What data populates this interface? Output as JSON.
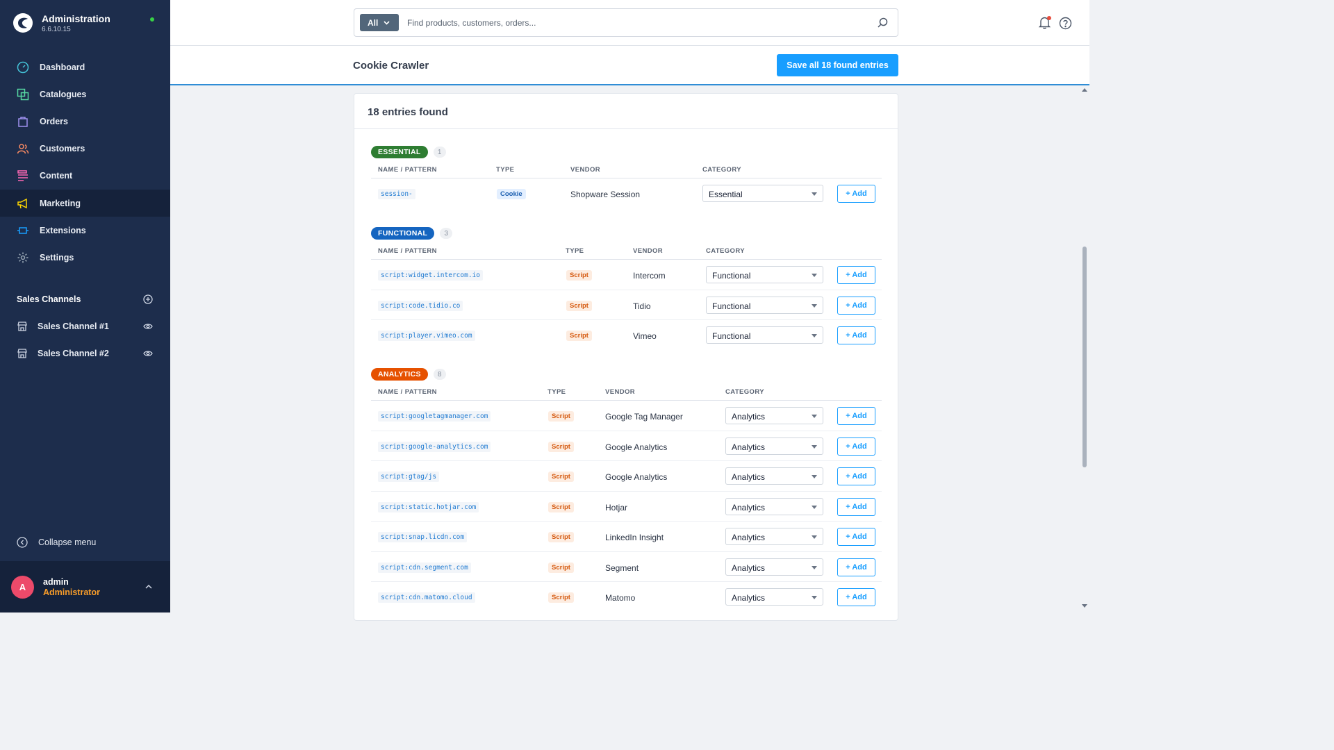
{
  "app": {
    "title": "Administration",
    "version": "6.6.10.15"
  },
  "nav": [
    {
      "label": "Dashboard",
      "icon": "dashboard-icon",
      "color": "#44c3d8"
    },
    {
      "label": "Catalogues",
      "icon": "catalogues-icon",
      "color": "#57d9a3"
    },
    {
      "label": "Orders",
      "icon": "orders-icon",
      "color": "#a092f0"
    },
    {
      "label": "Customers",
      "icon": "customers-icon",
      "color": "#f88962"
    },
    {
      "label": "Content",
      "icon": "content-icon",
      "color": "#ff68b4"
    },
    {
      "label": "Marketing",
      "icon": "marketing-icon",
      "color": "#ffd700"
    },
    {
      "label": "Extensions",
      "icon": "extensions-icon",
      "color": "#189eff"
    },
    {
      "label": "Settings",
      "icon": "settings-icon",
      "color": "#9aa8b5"
    }
  ],
  "sales_channels": {
    "title": "Sales Channels",
    "items": [
      {
        "label": "Sales Channel #1"
      },
      {
        "label": "Sales Channel #2"
      }
    ]
  },
  "collapse_label": "Collapse menu",
  "user": {
    "initial": "A",
    "name": "admin",
    "role": "Administrator"
  },
  "search": {
    "scope": "All",
    "placeholder": "Find products, customers, orders..."
  },
  "page": {
    "title": "Cookie Crawler",
    "save_label": "Save all 18 found entries"
  },
  "card": {
    "heading": "18 entries found"
  },
  "columns": {
    "name": "NAME / PATTERN",
    "type": "TYPE",
    "vendor": "VENDOR",
    "category": "CATEGORY"
  },
  "add_label": "+ Add",
  "groups": [
    {
      "label": "ESSENTIAL",
      "count": "1",
      "color": "#2e7d32",
      "rows": [
        {
          "pattern": "session-",
          "type": "Cookie",
          "vendor": "Shopware Session",
          "category": "Essential"
        }
      ]
    },
    {
      "label": "FUNCTIONAL",
      "count": "3",
      "color": "#1565c0",
      "rows": [
        {
          "pattern": "script:widget.intercom.io",
          "type": "Script",
          "vendor": "Intercom",
          "category": "Functional"
        },
        {
          "pattern": "script:code.tidio.co",
          "type": "Script",
          "vendor": "Tidio",
          "category": "Functional"
        },
        {
          "pattern": "script:player.vimeo.com",
          "type": "Script",
          "vendor": "Vimeo",
          "category": "Functional"
        }
      ]
    },
    {
      "label": "ANALYTICS",
      "count": "8",
      "color": "#e65100",
      "rows": [
        {
          "pattern": "script:googletagmanager.com",
          "type": "Script",
          "vendor": "Google Tag Manager",
          "category": "Analytics"
        },
        {
          "pattern": "script:google-analytics.com",
          "type": "Script",
          "vendor": "Google Analytics",
          "category": "Analytics"
        },
        {
          "pattern": "script:gtag/js",
          "type": "Script",
          "vendor": "Google Analytics",
          "category": "Analytics"
        },
        {
          "pattern": "script:static.hotjar.com",
          "type": "Script",
          "vendor": "Hotjar",
          "category": "Analytics"
        },
        {
          "pattern": "script:snap.licdn.com",
          "type": "Script",
          "vendor": "LinkedIn Insight",
          "category": "Analytics"
        },
        {
          "pattern": "script:cdn.segment.com",
          "type": "Script",
          "vendor": "Segment",
          "category": "Analytics"
        },
        {
          "pattern": "script:cdn.matomo.cloud",
          "type": "Script",
          "vendor": "Matomo",
          "category": "Analytics"
        }
      ]
    }
  ],
  "colors": {
    "sidebar": "#1d2d4c",
    "accent": "#189eff",
    "role": "#f89d2a"
  }
}
